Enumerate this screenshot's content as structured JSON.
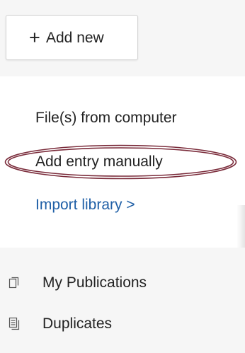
{
  "add_button": {
    "plus": "+",
    "label": "Add new"
  },
  "menu": {
    "items": [
      {
        "label": "File(s) from computer"
      },
      {
        "label": "Add entry manually",
        "highlighted": true
      },
      {
        "label": "Import library",
        "suffix": " >",
        "color": "#1f5fa6"
      }
    ],
    "highlight_color": "#7a2b3a"
  },
  "sidebar": {
    "items": [
      {
        "label": "My Publications",
        "icon": "publications-icon"
      },
      {
        "label": "Duplicates",
        "icon": "duplicates-icon"
      }
    ]
  }
}
